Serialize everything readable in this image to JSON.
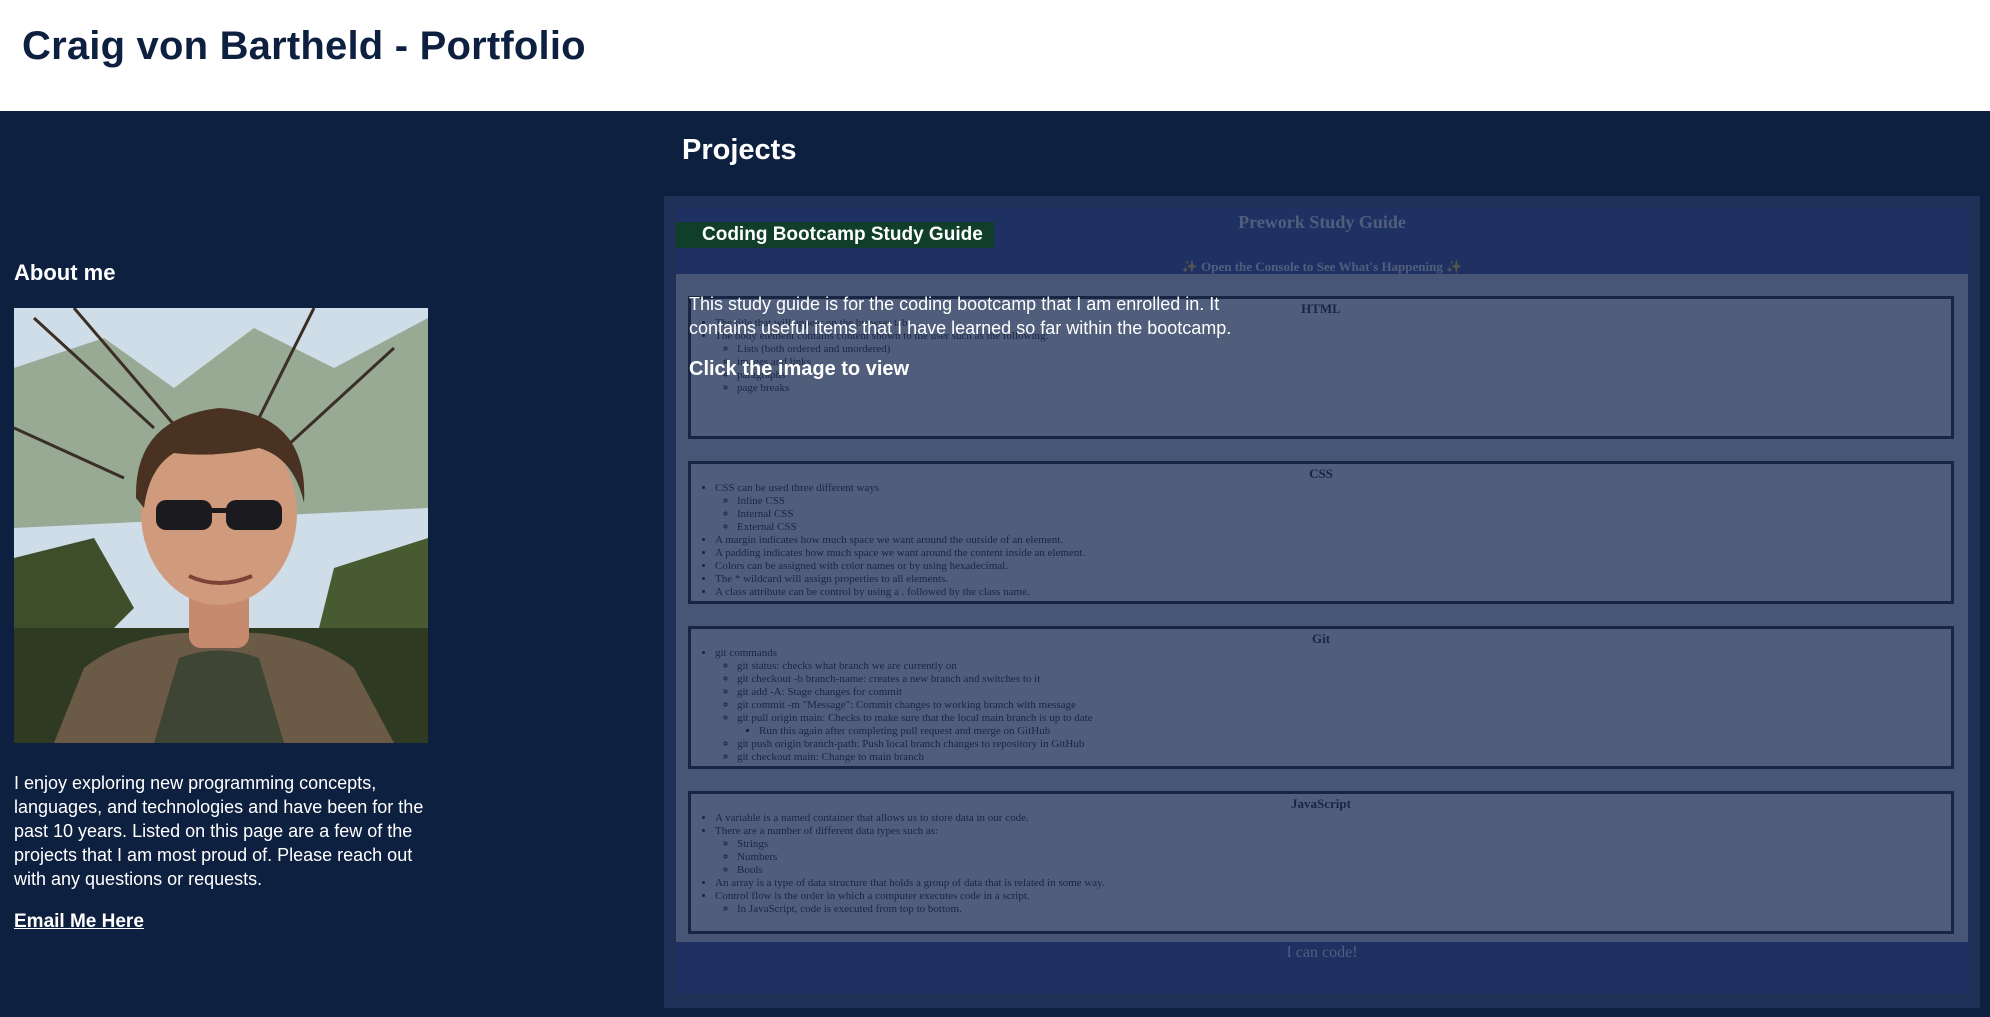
{
  "header": {
    "title": "Craig von Bartheld - Portfolio"
  },
  "about": {
    "heading": "About me",
    "bio": "I enjoy exploring new programming concepts, languages, and technologies and have been for the past 10 years. Listed on this page are a few of the projects that I am most proud of. Please reach out with any questions or requests.",
    "email_link": "Email Me Here"
  },
  "projects": {
    "heading": "Projects",
    "items": [
      {
        "name": "Coding Bootcamp Study Guide",
        "description": "This study guide is for the coding bootcamp that I am enrolled in. It contains useful items that I have learned so far within the bootcamp.",
        "cta": "Click the image to view",
        "preview": {
          "title": "Prework Study Guide",
          "subtitle": "✨ Open the Console to See What's Happening ✨",
          "footer": "I can code!",
          "sections": [
            {
              "title": "HTML",
              "items": [
                "The title that will appear on the browser tab",
                "The body element contains content shown to the user such as the following:",
                "Lists (both ordered and unordered)",
                "images and links",
                "paragraphs",
                "page breaks"
              ]
            },
            {
              "title": "CSS",
              "items": [
                "CSS can be used three different ways",
                "Inline CSS",
                "Internal CSS",
                "External CSS",
                "A margin indicates how much space we want around the outside of an element.",
                "A padding indicates how much space we want around the content inside an element.",
                "Colors can be assigned with color names or by using hexadecimal.",
                "The * wildcard will assign properties to all elements.",
                "A class attribute can be control by using a . followed by the class name."
              ]
            },
            {
              "title": "Git",
              "items": [
                "git commands",
                "git status: checks what branch we are currently on",
                "git checkout -b branch-name: creates a new branch and switches to it",
                "git add -A: Stage changes for commit",
                "git commit -m \"Message\": Commit changes to working branch with message",
                "git pull origin main: Checks to make sure that the local main branch is up to date",
                "Run this again after completing pull request and merge on GitHub",
                "git push origin branch-path: Push local branch changes to repository in GitHub",
                "git checkout main: Change to main branch"
              ]
            },
            {
              "title": "JavaScript",
              "items": [
                "A variable is a named container that allows us to store data in our code.",
                "There are a number of different data types such as:",
                "Strings",
                "Numbers",
                "Bools",
                "An array is a type of data structure that holds a group of data that is related in some way.",
                "Control flow is the order in which a computer executes code in a script.",
                "In JavaScript, code is executed from top to bottom."
              ]
            }
          ]
        }
      }
    ]
  },
  "colors": {
    "page_background": "#0e2040",
    "header_background": "#ffffff",
    "title_color": "#0e2040",
    "project_tag_background": "#103e2b",
    "preview_band": "#1f2f8f"
  }
}
